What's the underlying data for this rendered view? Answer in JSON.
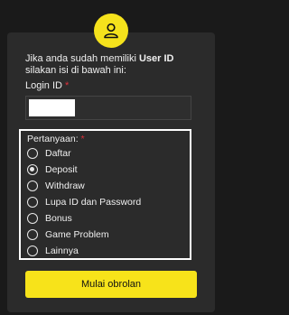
{
  "intro": {
    "text_before": "Jika anda sudah memiliki ",
    "text_bold": "User ID",
    "text_after": "silakan isi di bawah ini:"
  },
  "login": {
    "label": "Login ID",
    "required_mark": "*",
    "value": ""
  },
  "question": {
    "label": "Pertanyaan:",
    "required_mark": "*",
    "options": [
      {
        "label": "Daftar",
        "checked": false
      },
      {
        "label": "Deposit",
        "checked": true
      },
      {
        "label": "Withdraw",
        "checked": false
      },
      {
        "label": "Lupa ID dan Password",
        "checked": false
      },
      {
        "label": "Bonus",
        "checked": false
      },
      {
        "label": "Game Problem",
        "checked": false
      },
      {
        "label": "Lainnya",
        "checked": false
      }
    ]
  },
  "start_button": {
    "label": "Mulai obrolan"
  },
  "colors": {
    "accent": "#f7e31a",
    "background": "#1a1a1a",
    "card": "#2b2b2b",
    "required": "#e0303a"
  }
}
